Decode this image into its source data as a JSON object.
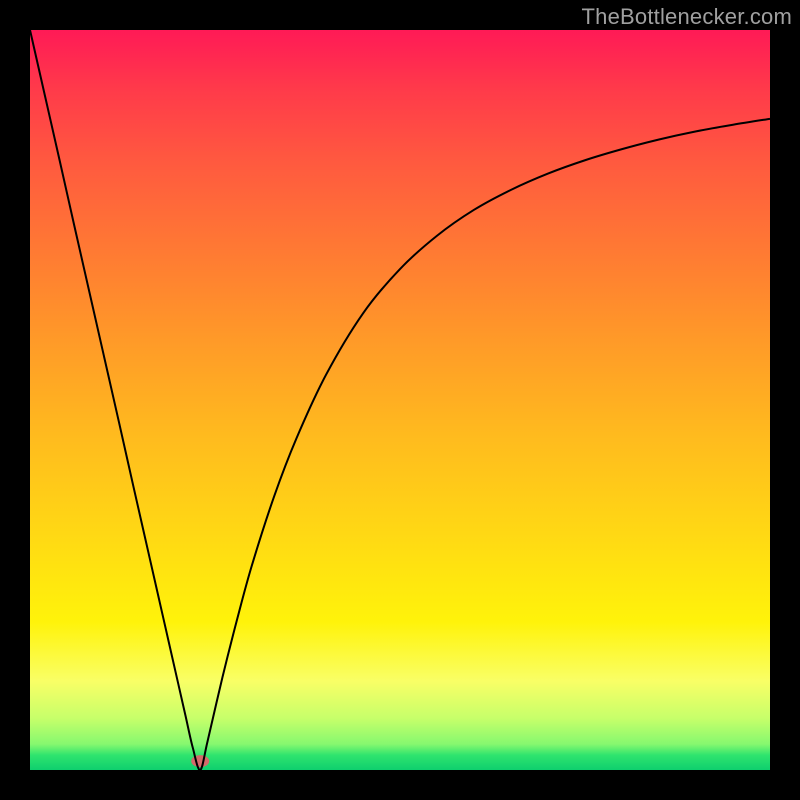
{
  "watermark": {
    "text": "TheBottlenecker.com"
  },
  "chart_data": {
    "type": "line",
    "title": "",
    "xlabel": "",
    "ylabel": "",
    "xlim": [
      0,
      100
    ],
    "ylim": [
      0,
      100
    ],
    "background_gradient": {
      "direction": "vertical",
      "stops": [
        {
          "pos": 0,
          "color": "#ff1a56"
        },
        {
          "pos": 8,
          "color": "#ff3a4a"
        },
        {
          "pos": 18,
          "color": "#ff5a3f"
        },
        {
          "pos": 30,
          "color": "#ff7a33"
        },
        {
          "pos": 42,
          "color": "#ff9a28"
        },
        {
          "pos": 55,
          "color": "#ffbb1e"
        },
        {
          "pos": 68,
          "color": "#ffd814"
        },
        {
          "pos": 80,
          "color": "#fff30a"
        },
        {
          "pos": 88,
          "color": "#f9ff66"
        },
        {
          "pos": 93,
          "color": "#c7ff6a"
        },
        {
          "pos": 96.5,
          "color": "#86f86f"
        },
        {
          "pos": 98,
          "color": "#2fe46e"
        },
        {
          "pos": 100,
          "color": "#0ecf6e"
        }
      ]
    },
    "series": [
      {
        "name": "bottleneck-curve",
        "color": "#000000",
        "stroke_width": 2,
        "x": [
          0,
          2,
          4,
          6,
          8,
          10,
          12,
          14,
          16,
          18,
          20,
          21,
          22,
          23,
          24,
          26,
          28,
          30,
          33,
          36,
          40,
          45,
          50,
          55,
          60,
          65,
          70,
          75,
          80,
          85,
          90,
          95,
          100
        ],
        "y": [
          100,
          91.2,
          82.4,
          73.5,
          64.7,
          55.9,
          47.1,
          38.2,
          29.4,
          20.6,
          11.8,
          7.4,
          3.0,
          0.0,
          3.9,
          12.5,
          20.4,
          27.7,
          37.0,
          44.8,
          53.4,
          61.7,
          67.7,
          72.2,
          75.7,
          78.4,
          80.6,
          82.4,
          83.9,
          85.2,
          86.3,
          87.2,
          88.0
        ]
      }
    ],
    "marker": {
      "name": "current-point",
      "x": 23,
      "y": 1.2,
      "color": "#d46a6a",
      "rx": 9,
      "ry": 6
    }
  }
}
